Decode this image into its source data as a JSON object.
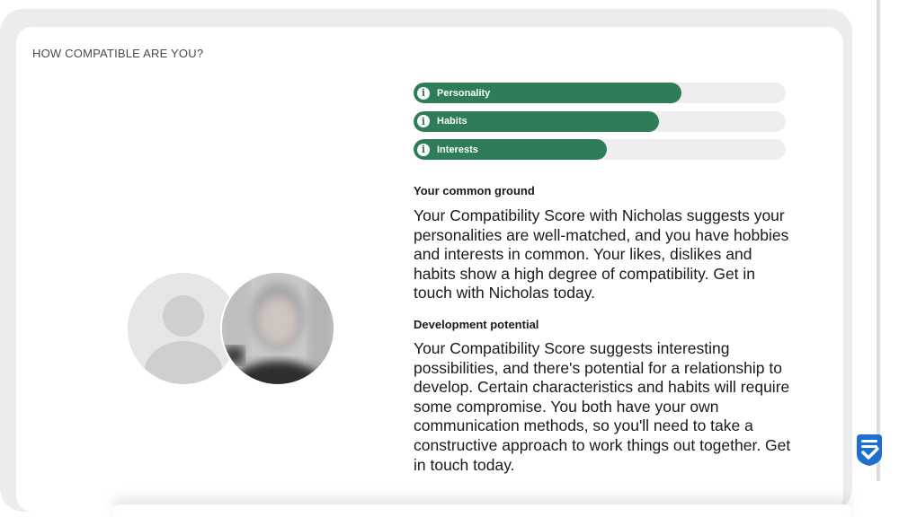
{
  "section": {
    "title": "HOW COMPATIBLE ARE YOU?"
  },
  "bars": [
    {
      "label": "Personality",
      "fill": 0.72,
      "icon": "info-icon"
    },
    {
      "label": "Habits",
      "fill": 0.66,
      "icon": "info-icon"
    },
    {
      "label": "Interests",
      "fill": 0.52,
      "icon": "info-icon"
    }
  ],
  "common_ground": {
    "heading": "Your common ground",
    "text": "Your Compatibility Score with Nicholas suggests your personalities are well-matched, and you have hobbies and interests in common. Your likes, dislikes and habits show a high degree of compatibility. Get in touch with Nicholas today."
  },
  "development": {
    "heading": "Development potential",
    "text": "Your Compatibility Score suggests interesting possibilities, and there's potential for a relationship to develop. Certain characteristics and habits will require some compromise. You both have your own communication methods, so you'll need to take a constructive approach to work things out together. Get in touch today."
  },
  "colors": {
    "bar_fill": "#2e7d58",
    "bar_track": "#eeeeee",
    "page_frame": "#ececec"
  },
  "icons": {
    "info": "i",
    "badge": "checklist-shield-icon"
  }
}
